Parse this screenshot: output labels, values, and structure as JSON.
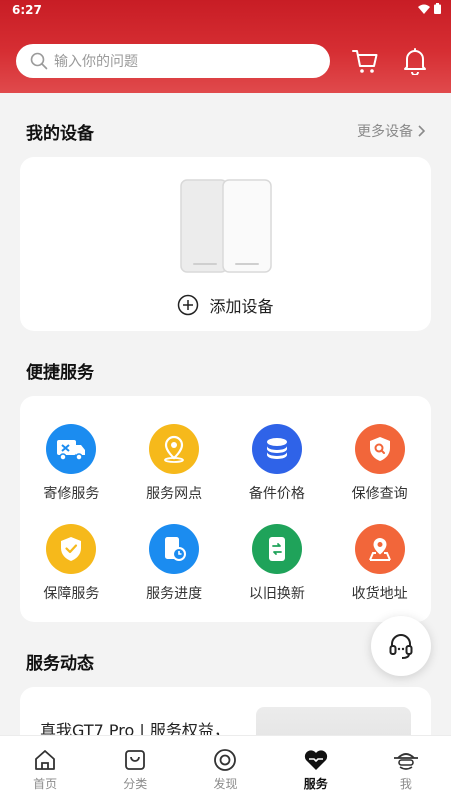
{
  "status_bar": {
    "time": "6:27"
  },
  "header": {
    "search_placeholder": "输入你的问题"
  },
  "my_devices": {
    "title": "我的设备",
    "more_label": "更多设备",
    "add_label": "添加设备"
  },
  "quick_services": {
    "title": "便捷服务",
    "items": [
      {
        "label": "寄修服务",
        "icon": "truck-wrench-icon",
        "color": "#1b8cf0"
      },
      {
        "label": "服务网点",
        "icon": "location-pin-icon",
        "color": "#f6b91b"
      },
      {
        "label": "备件价格",
        "icon": "coin-stack-icon",
        "color": "#2f63e8"
      },
      {
        "label": "保修查询",
        "icon": "shield-search-icon",
        "color": "#f2663a"
      },
      {
        "label": "保障服务",
        "icon": "shield-check-icon",
        "color": "#f6b91b"
      },
      {
        "label": "服务进度",
        "icon": "phone-clock-icon",
        "color": "#1b8cf0"
      },
      {
        "label": "以旧换新",
        "icon": "trade-in-icon",
        "color": "#1fa35a"
      },
      {
        "label": "收货地址",
        "icon": "address-pin-icon",
        "color": "#f2663a"
      }
    ]
  },
  "service_news": {
    "title": "服务动态",
    "headline": "真我GT7 Pro | 服务权益，"
  },
  "tabbar": {
    "items": [
      {
        "label": "首页",
        "icon": "home-icon"
      },
      {
        "label": "分类",
        "icon": "category-icon"
      },
      {
        "label": "发现",
        "icon": "discover-icon"
      },
      {
        "label": "服务",
        "icon": "heart-service-icon",
        "active": true
      },
      {
        "label": "我",
        "icon": "profile-icon"
      }
    ]
  },
  "colors": {
    "brand_red": "#d62e33",
    "active_tab": "#111111",
    "inactive_tab": "#8c8c8c"
  }
}
